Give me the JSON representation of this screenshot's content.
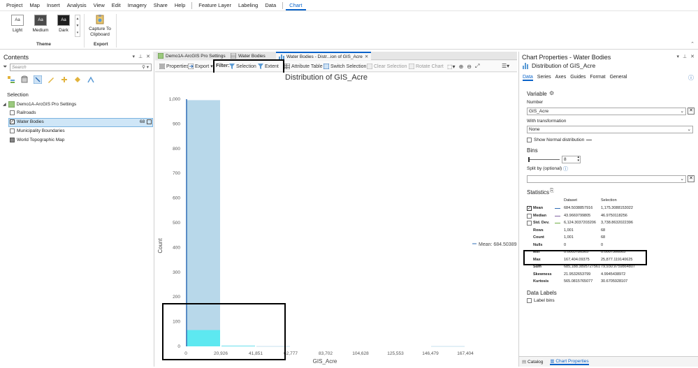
{
  "menu": {
    "items": [
      "Project",
      "Map",
      "Insert",
      "Analysis",
      "View",
      "Edit",
      "Imagery",
      "Share",
      "Help"
    ],
    "context_items": [
      "Feature Layer",
      "Labeling",
      "Data"
    ],
    "active_tab": "Chart"
  },
  "ribbon": {
    "themes": [
      "Light",
      "Medium",
      "Dark"
    ],
    "swatch_text": "Aa",
    "theme_group": "Theme",
    "capture_line1": "Capture To",
    "capture_line2": "Clipboard",
    "export_group": "Export"
  },
  "contents": {
    "title": "Contents",
    "search_placeholder": "Search",
    "section": "Selection",
    "map_name": "Demo1A-ArcGIS Pro Settings",
    "layers": [
      {
        "name": "Railroads",
        "checked": false
      },
      {
        "name": "Water Bodies",
        "checked": true,
        "count": "68",
        "selected": true
      },
      {
        "name": "Municipality Boundaries",
        "checked": false
      },
      {
        "name": "World Topographic Map",
        "checked": false
      }
    ]
  },
  "view_tabs": [
    {
      "label": "Demo1A-ArcGIS Pro Settings"
    },
    {
      "label": "Water Bodies"
    },
    {
      "label": "Water Bodies - Distr...ion of GIS_Acre",
      "active": true
    }
  ],
  "chart_toolbar": {
    "properties": "Properties",
    "export": "Export",
    "filter": "Filter:",
    "selection": "Selection",
    "extent": "Extent",
    "attribute_table": "Attribute Table",
    "switch_selection": "Switch Selection",
    "clear_selection": "Clear Selection",
    "rotate_chart": "Rotate Chart"
  },
  "chart_data": {
    "type": "bar",
    "title": "Distribution of GIS_Acre",
    "xlabel": "GIS_Acre",
    "ylabel": "Count",
    "ylim": [
      0,
      1000
    ],
    "yticks": [
      "0",
      "100",
      "200",
      "300",
      "400",
      "500",
      "600",
      "700",
      "800",
      "900",
      "1,000"
    ],
    "xticks": [
      "0",
      "20,926",
      "41,851",
      "62,777",
      "83,702",
      "104,628",
      "125,553",
      "146,479",
      "167,404"
    ],
    "series": [
      {
        "name": "Dataset",
        "color": "#b8d8ea",
        "values": [
          996,
          3,
          1,
          0,
          0,
          0,
          0,
          1
        ]
      },
      {
        "name": "Selection",
        "color": "#5de8f0",
        "values": [
          66,
          2,
          0,
          0,
          0,
          0,
          0,
          0
        ]
      }
    ],
    "mean_label": "Mean: 684.50389",
    "grid": false
  },
  "props": {
    "title": "Chart Properties - Water Bodies",
    "subtitle": "Distribution of GIS_Acre",
    "tabs": [
      "Data",
      "Series",
      "Axes",
      "Guides",
      "Format",
      "General"
    ],
    "variable_heading": "Variable",
    "number_label": "Number",
    "number_value": "GIS_Acre",
    "transform_label": "With transformation",
    "transform_value": "None",
    "normal_dist": "Show Normal distribution",
    "bins_heading": "Bins",
    "bins_value": "8",
    "split_label": "Split by (optional)",
    "statistics_heading": "Statistics",
    "stats_cols": [
      "Dataset",
      "Selection"
    ],
    "stats": [
      {
        "label": "Mean",
        "checked": true,
        "dataset": "684.5038857916",
        "selection": "1,175.3088153022"
      },
      {
        "label": "Median",
        "checked": false,
        "dataset": "43.9669799805",
        "selection": "46.9750118256"
      },
      {
        "label": "Std. Dev.",
        "checked": false,
        "dataset": "6,124.3037203206",
        "selection": "3,738.8632022396"
      },
      {
        "label": "Rows",
        "dataset": "1,001",
        "selection": "68"
      },
      {
        "label": "Count",
        "dataset": "1,001",
        "selection": "68"
      },
      {
        "label": "Nulls",
        "dataset": "0",
        "selection": "0"
      },
      {
        "label": "Min",
        "dataset": "0.0005786565",
        "selection": "0.0007566065"
      },
      {
        "label": "Max",
        "dataset": "167,404.09375",
        "selection": "25,877.119140625"
      },
      {
        "label": "Sum",
        "dataset": "685,188.3895727561",
        "selection": "79,930.9759864807"
      },
      {
        "label": "Skewness",
        "dataset": "21.9532653799",
        "selection": "4.9945438972"
      },
      {
        "label": "Kurtosis",
        "dataset": "565.0815765077",
        "selection": "30.6705928107"
      }
    ],
    "data_labels_heading": "Data Labels",
    "label_bins": "Label bins",
    "bottom_tabs": [
      "Catalog",
      "Chart Properties"
    ]
  }
}
